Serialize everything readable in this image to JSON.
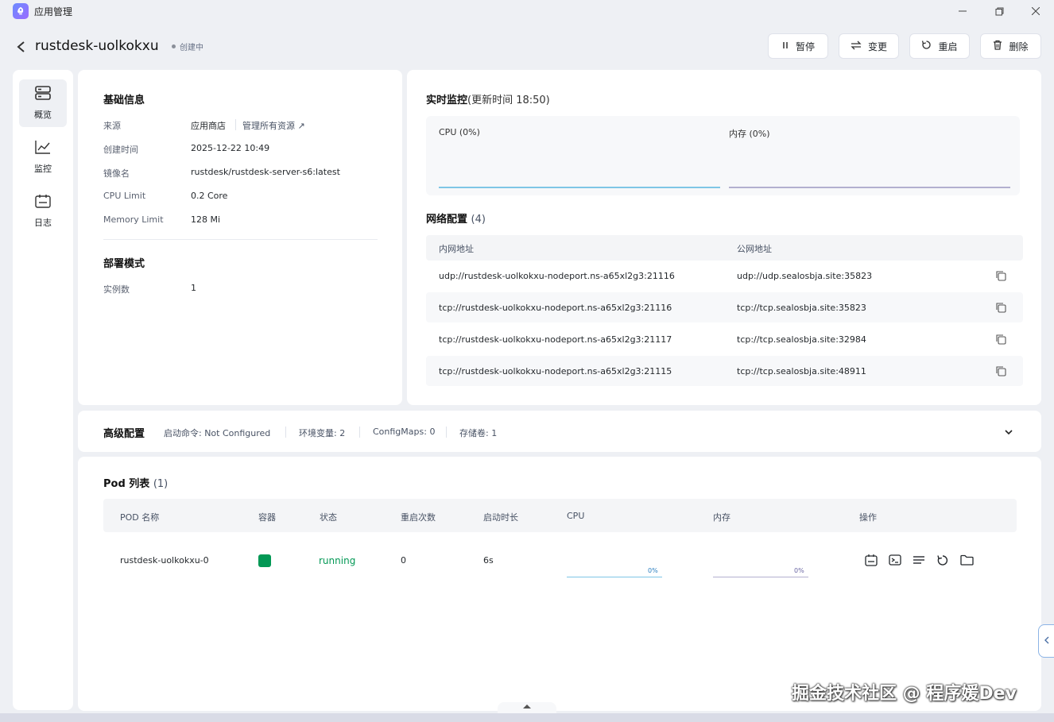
{
  "window": {
    "title": "应用管理",
    "logo_icon": "rocket-icon"
  },
  "header": {
    "app_name": "rustdesk-uolkokxu",
    "status": "创建中",
    "buttons": {
      "pause": "暂停",
      "change": "变更",
      "restart": "重启",
      "delete": "删除"
    }
  },
  "nav": {
    "overview": "概览",
    "monitor": "监控",
    "logs": "日志"
  },
  "basic_info": {
    "title": "基础信息",
    "source_label": "来源",
    "source_value": "应用商店",
    "source_link": "管理所有资源",
    "created_label": "创建时间",
    "created_value": "2025-12-22 10:49",
    "image_label": "镜像名",
    "image_value": "rustdesk/rustdesk-server-s6:latest",
    "cpu_label": "CPU Limit",
    "cpu_value": "0.2 Core",
    "mem_label": "Memory Limit",
    "mem_value": "128 Mi"
  },
  "deploy": {
    "title": "部署模式",
    "replicas_label": "实例数",
    "replicas_value": "1"
  },
  "monitor": {
    "title": "实时监控",
    "update_time": "(更新时间  18:50)",
    "cpu_label": "CPU  (0%)",
    "mem_label": "内存  (0%)",
    "cpu_color": "#7fc6e6",
    "mem_color": "#b3b0cf"
  },
  "network": {
    "title": "网络配置",
    "count": "(4)",
    "col_private": "内网地址",
    "col_public": "公网地址",
    "rows": [
      {
        "private": "udp://rustdesk-uolkokxu-nodeport.ns-a65xl2g3:21116",
        "public": "udp://udp.sealosbja.site:35823"
      },
      {
        "private": "tcp://rustdesk-uolkokxu-nodeport.ns-a65xl2g3:21116",
        "public": "tcp://tcp.sealosbja.site:35823"
      },
      {
        "private": "tcp://rustdesk-uolkokxu-nodeport.ns-a65xl2g3:21117",
        "public": "tcp://tcp.sealosbja.site:32984"
      },
      {
        "private": "tcp://rustdesk-uolkokxu-nodeport.ns-a65xl2g3:21115",
        "public": "tcp://tcp.sealosbja.site:48911"
      }
    ]
  },
  "advanced": {
    "title": "高级配置",
    "command": "启动命令: Not Configured",
    "env": "环境变量: 2",
    "configmaps": "ConfigMaps: 0",
    "volumes": "存储卷: 1"
  },
  "pods": {
    "title": "Pod 列表",
    "count": "(1)",
    "headers": {
      "name": "POD 名称",
      "container": "容器",
      "status": "状态",
      "restarts": "重启次数",
      "uptime": "启动时长",
      "cpu": "CPU",
      "memory": "内存",
      "actions": "操作"
    },
    "row": {
      "name": "rustdesk-uolkokxu-0",
      "container_color": "#039855",
      "status": "running",
      "status_color": "#039855",
      "restarts": "0",
      "uptime": "6s",
      "cpu_pct": "0%",
      "mem_pct": "0%"
    }
  },
  "watermark": "掘金技术社区 @ 程序媛Dev"
}
